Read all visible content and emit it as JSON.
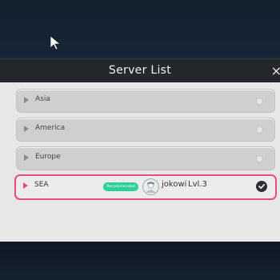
{
  "dialog": {
    "title": "Server List",
    "close_label": "×"
  },
  "servers": [
    {
      "name": "Asia",
      "selected": false
    },
    {
      "name": "America",
      "selected": false
    },
    {
      "name": "Europe",
      "selected": false
    },
    {
      "name": "SEA",
      "selected": true,
      "badge": "Recommended",
      "player_name": "jokowi",
      "player_level": "Lvl.3"
    }
  ],
  "colors": {
    "selected_border": "#e84a86",
    "badge": "#2fcf9a",
    "panel": "#e7e7e7",
    "header": "#24272c"
  },
  "icons": {
    "row": "triangle-right-icon",
    "status": "radio-dot-icon",
    "selected": "check-circle-icon"
  }
}
